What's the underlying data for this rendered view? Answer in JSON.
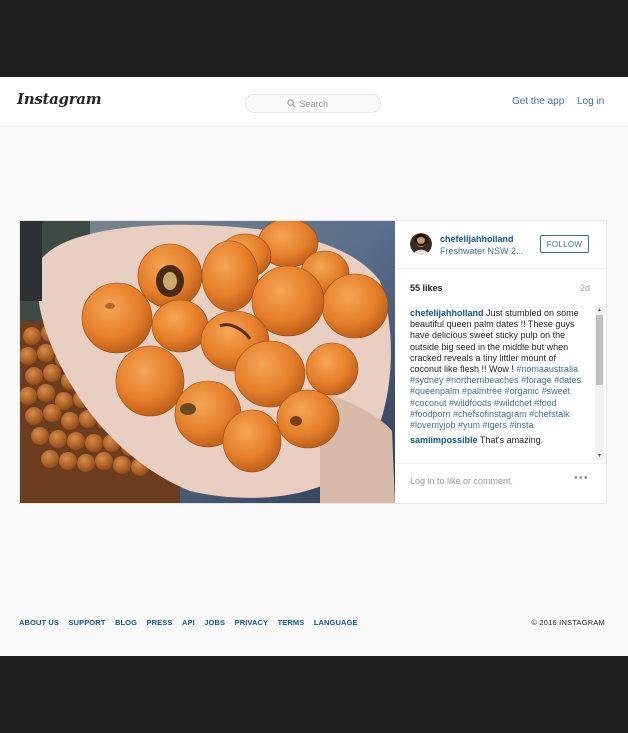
{
  "navbar": {
    "logo": "Instagram",
    "search_placeholder": "Search",
    "get_app": "Get the app",
    "login": "Log in"
  },
  "post": {
    "username": "chefelijahholland",
    "location": "Freshwater NSW 2...",
    "follow_label": "FOLLOW",
    "likes": "55 likes",
    "age": "2d",
    "caption_user": "chefelijahholland",
    "caption_text": "Just stumbled on some beautiful queen palm dates !! These guys have delicious sweet sticky pulp on the outside big seed in the middle but when cracked reveals a tiny littler mount of coconut like flesh !! Wow !",
    "caption_tags": "#nomaaustralia #sydney #northernbeaches #forage #dates #queenpalm #palmtree #organic #sweet #coconut #wildfoods #wildchef #food #foodporn #chefsofinstagram #chefstalk #lovemyjob #yum #igers #insta",
    "comment_user": "samiimpossible",
    "comment_text": "That's amazing.",
    "login_to_comment": "Log in to like or comment.",
    "more_icon": "ellipsis-icon"
  },
  "footer": {
    "links": [
      "ABOUT US",
      "SUPPORT",
      "BLOG",
      "PRESS",
      "API",
      "JOBS",
      "PRIVACY",
      "TERMS",
      "LANGUAGE"
    ],
    "copyright": "© 2016 INSTAGRAM"
  },
  "colors": {
    "link": "#3f729b",
    "username": "#125688",
    "frame": "#1f1f1f",
    "page_bg": "#fafafa"
  }
}
